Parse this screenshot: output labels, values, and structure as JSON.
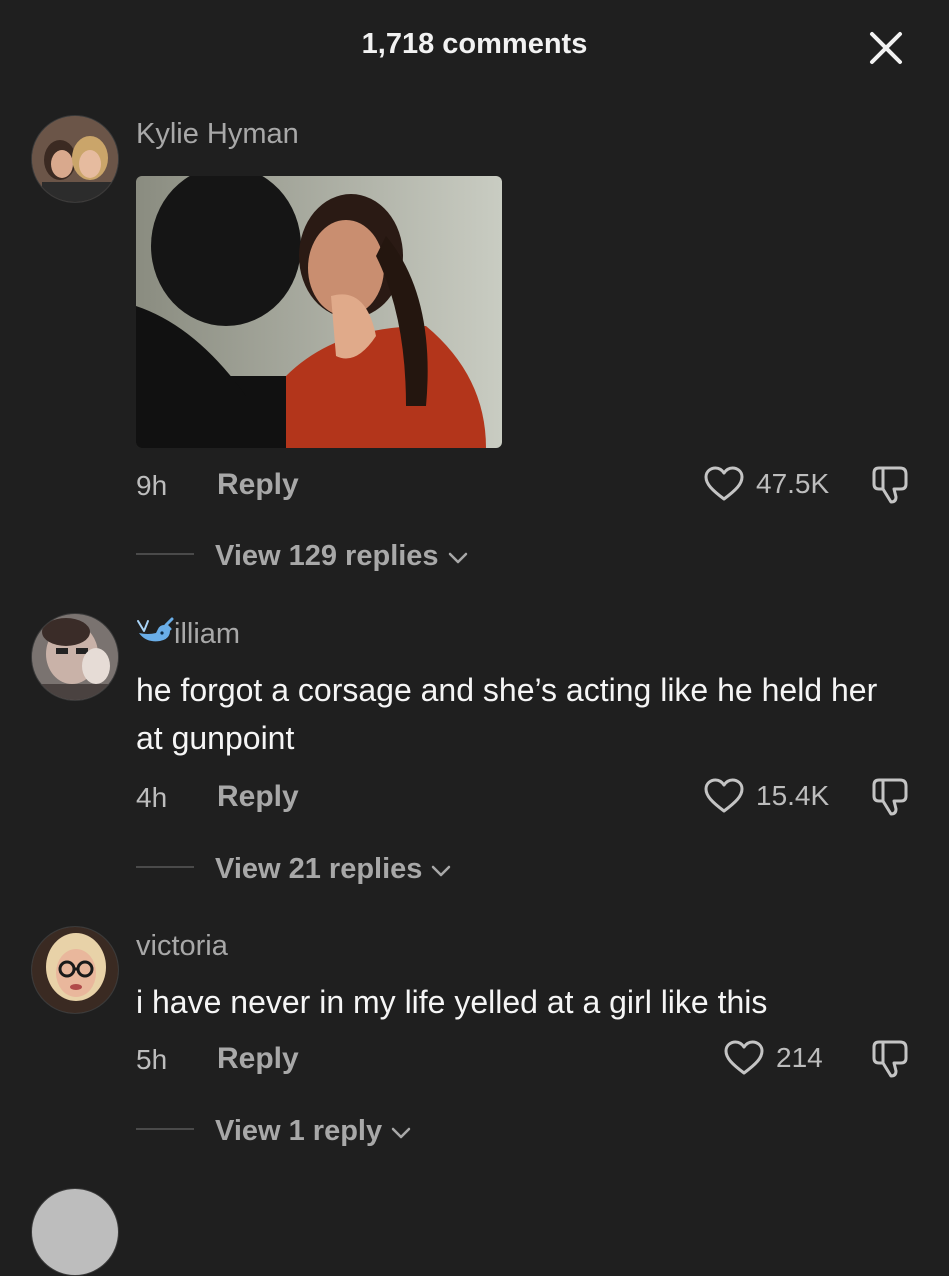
{
  "header": {
    "title": "1,718 comments"
  },
  "comments": [
    {
      "username": "Kylie Hyman",
      "text": "",
      "time": "9h",
      "reply_label": "Reply",
      "likes": "47.5K",
      "view_replies": "View 129 replies"
    },
    {
      "username": "illiam",
      "text": "he forgot a corsage and she’s acting like he held her at gunpoint",
      "time": "4h",
      "reply_label": "Reply",
      "likes": "15.4K",
      "view_replies": "View 21 replies"
    },
    {
      "username": "victoria",
      "text": "i have never in my life yelled at a girl like this",
      "time": "5h",
      "reply_label": "Reply",
      "likes": "214",
      "view_replies": "View 1 reply"
    }
  ],
  "colors": {
    "background": "#1f1f1f",
    "secondary_text": "#a8a8a8",
    "primary_text": "#f5f5f5"
  },
  "icons": {
    "close": "close-icon",
    "like": "heart-icon",
    "dislike": "thumbs-down-icon",
    "expand": "chevron-down-icon",
    "username_emoji": "whale-emoji"
  }
}
